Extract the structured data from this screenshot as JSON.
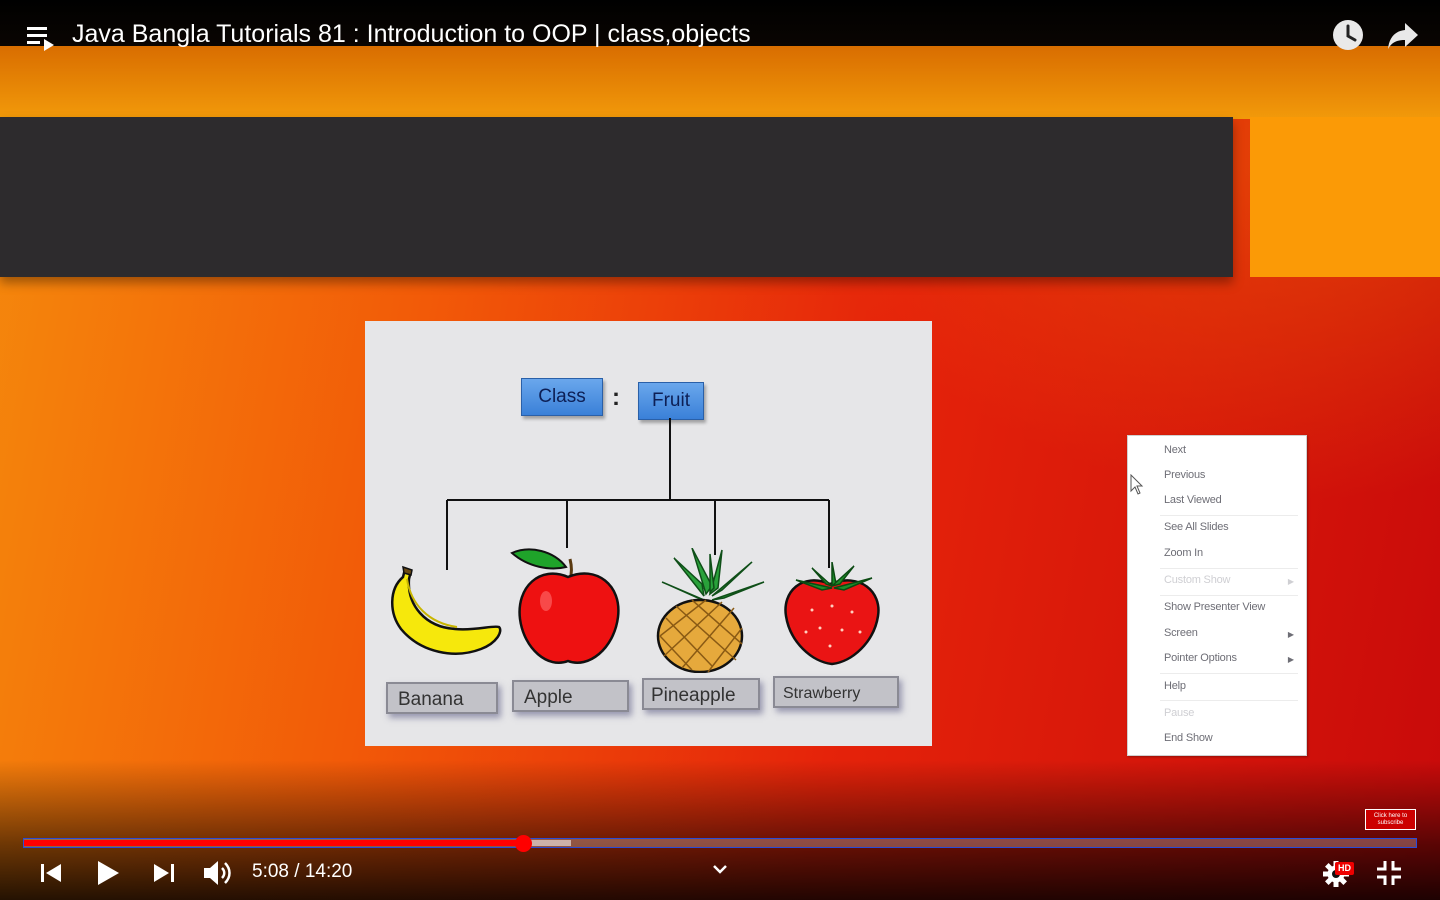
{
  "video": {
    "title": "Java Bangla Tutorials 81 : Introduction to OOP | class,objects",
    "current_time": "5:08",
    "time_separator": "/",
    "duration": "14:20",
    "time_display": "5:08 / 14:20",
    "progress_fraction": 0.3584,
    "buffered_fraction": 0.393,
    "quality_badge": "HD",
    "subscribe_overlay": "Click here to subscribe"
  },
  "player_icons": {
    "playlist": "playlist-icon",
    "watch_later": "clock-icon",
    "share": "share-icon",
    "previous": "skip-previous-icon",
    "play": "play-icon",
    "next": "skip-next-icon",
    "volume": "volume-icon",
    "more": "chevron-down-icon",
    "settings": "gear-icon",
    "exit_fullscreen": "exit-fullscreen-icon"
  },
  "slide": {
    "class_label": "Class",
    "colon": ":",
    "root_label": "Fruit",
    "fruits": [
      {
        "label": "Banana",
        "icon": "banana-icon"
      },
      {
        "label": "Apple",
        "icon": "apple-icon"
      },
      {
        "label": "Pineapple",
        "icon": "pineapple-icon"
      },
      {
        "label": "Strawberry",
        "icon": "strawberry-icon"
      }
    ]
  },
  "context_menu": {
    "items": [
      {
        "label": "Next",
        "enabled": true
      },
      {
        "label": "Previous",
        "enabled": true
      },
      {
        "label": "Last Viewed",
        "enabled": true
      },
      {
        "label": "See All Slides",
        "enabled": true
      },
      {
        "label": "Zoom In",
        "enabled": true
      },
      {
        "label": "Custom Show",
        "enabled": false
      },
      {
        "label": "Show Presenter View",
        "enabled": true
      },
      {
        "label": "Screen",
        "enabled": true
      },
      {
        "label": "Pointer Options",
        "enabled": true
      },
      {
        "label": "Help",
        "enabled": true
      },
      {
        "label": "Pause",
        "enabled": false
      },
      {
        "label": "End Show",
        "enabled": true
      }
    ]
  },
  "colors": {
    "progress_played": "#ff0000",
    "slide_background": "#e6e6e8",
    "label_blue": "#3a80d8"
  }
}
